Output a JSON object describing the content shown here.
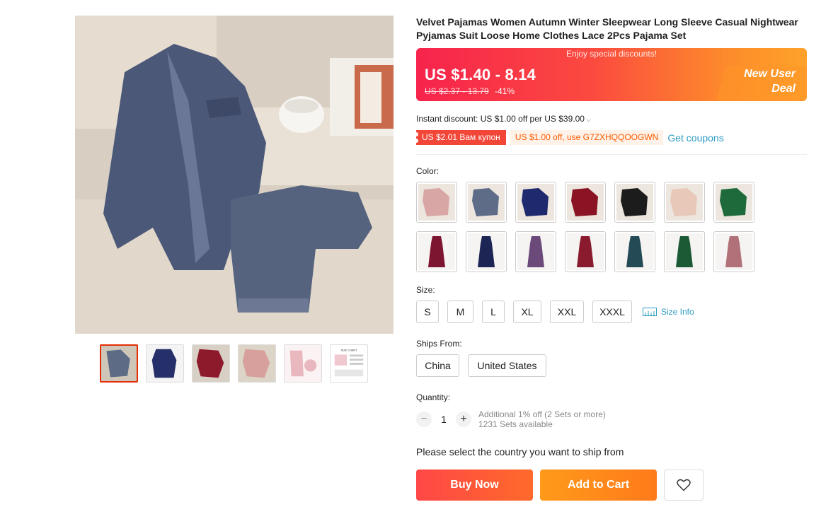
{
  "product": {
    "title": "Velvet Pajamas Women Autumn Winter Sleepwear Long Sleeve Casual Nightwear Pyjamas Suit Loose Home Clothes Lace 2Pcs Pajama Set"
  },
  "gallery": {
    "main_image_icon": "pajama-photo",
    "thumbnails": [
      {
        "name": "thumb-grey-velvet",
        "color": "#5d6b85"
      },
      {
        "name": "thumb-navy-velvet",
        "color": "#25306b"
      },
      {
        "name": "thumb-burgundy-velvet",
        "color": "#8c1a2a"
      },
      {
        "name": "thumb-pink-velvet",
        "color": "#d7a09c"
      },
      {
        "name": "thumb-pink-set",
        "color": "#e9b8bf"
      },
      {
        "name": "thumb-size-chart",
        "color": "#f5f5f5",
        "label": "SIZE CHART"
      }
    ]
  },
  "price": {
    "enjoy_text": "Enjoy special discounts!",
    "current": "US $1.40 - 8.14",
    "original": "US $2.37 - 13.79",
    "discount_pct": "-41%",
    "promo_line1": "New User",
    "promo_line2": "Deal",
    "banner_colors": [
      "#f7234d",
      "#fea22a"
    ]
  },
  "discounts": {
    "instant": "Instant discount: US $1.00 off per US $39.00",
    "coupon_red": "US $2.01 Вам купон",
    "coupon_orange": "US $1.00 off, use G7ZXHQQOOGWN",
    "get_coupons": "Get coupons"
  },
  "color": {
    "label": "Color:",
    "swatches": [
      {
        "name": "swatch-pink-velvet",
        "color": "#d9a6a6"
      },
      {
        "name": "swatch-grey-velvet",
        "color": "#5e6c88"
      },
      {
        "name": "swatch-navy-velvet",
        "color": "#1f2a6e"
      },
      {
        "name": "swatch-wine-velvet",
        "color": "#8a1424"
      },
      {
        "name": "swatch-black-lace",
        "color": "#1c1c1c"
      },
      {
        "name": "swatch-champagne-lace",
        "color": "#e8c8b8"
      },
      {
        "name": "swatch-green-velvet",
        "color": "#1f6a3a"
      },
      {
        "name": "swatch-wine-cami",
        "color": "#7d1530"
      },
      {
        "name": "swatch-navy-cami",
        "color": "#1d2555"
      },
      {
        "name": "swatch-purple-cami",
        "color": "#6b4a7a"
      },
      {
        "name": "swatch-wine-dress",
        "color": "#8a1a2e"
      },
      {
        "name": "swatch-teal-dress",
        "color": "#234a55"
      },
      {
        "name": "swatch-green-dress",
        "color": "#1b5a34"
      },
      {
        "name": "swatch-rose-dress",
        "color": "#b07278"
      }
    ]
  },
  "size": {
    "label": "Size:",
    "options": [
      "S",
      "M",
      "L",
      "XL",
      "XXL",
      "XXXL"
    ],
    "size_info": "Size Info"
  },
  "ships": {
    "label": "Ships From:",
    "options": [
      "China",
      "United States"
    ]
  },
  "quantity": {
    "label": "Quantity:",
    "value": "1",
    "minus": "−",
    "plus": "+",
    "offer": "Additional 1% off (2 Sets or more)",
    "available": "1231 Sets available"
  },
  "ship_prompt": "Please select the country you want to ship from",
  "actions": {
    "buy_now": "Buy Now",
    "add_to_cart": "Add to Cart",
    "wishlist_icon": "heart-icon"
  }
}
